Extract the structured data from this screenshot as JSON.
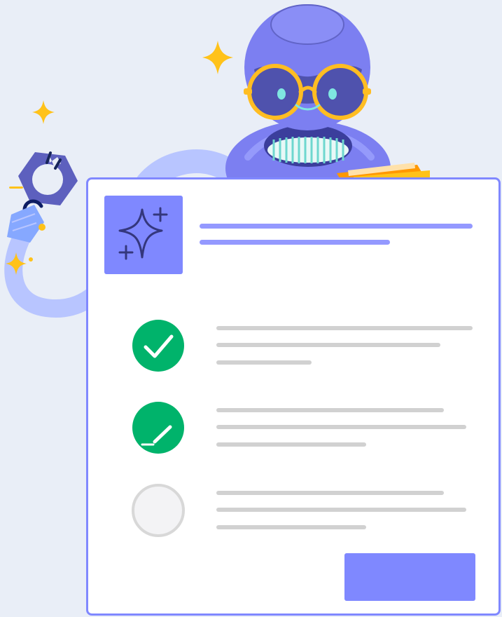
{
  "scene": {
    "background_color": "#e9eef7",
    "accent_color": "#7f88ff",
    "accent_light": "#b8c5ff",
    "success_color": "#00b36b",
    "inactive_color": "#f3f3f5",
    "sparkle_color": "#ffc21a",
    "robot_color": "#7c7ff1",
    "robot_dark": "#4f52ad",
    "glasses_color": "#ffbd22",
    "text_placeholder_color": "#d1d1d1",
    "icons": {
      "header": "sparkles-icon",
      "completed_step": "checkmark-icon",
      "active_step": "pencil-icon",
      "pending_step": "empty-circle-icon",
      "robot_hand": "gear-claw-icon"
    }
  },
  "checklist": {
    "steps": [
      {
        "state": "complete",
        "icon": "checkmark-icon"
      },
      {
        "state": "active",
        "icon": "pencil-icon"
      },
      {
        "state": "pending",
        "icon": "empty-circle-icon"
      }
    ]
  }
}
